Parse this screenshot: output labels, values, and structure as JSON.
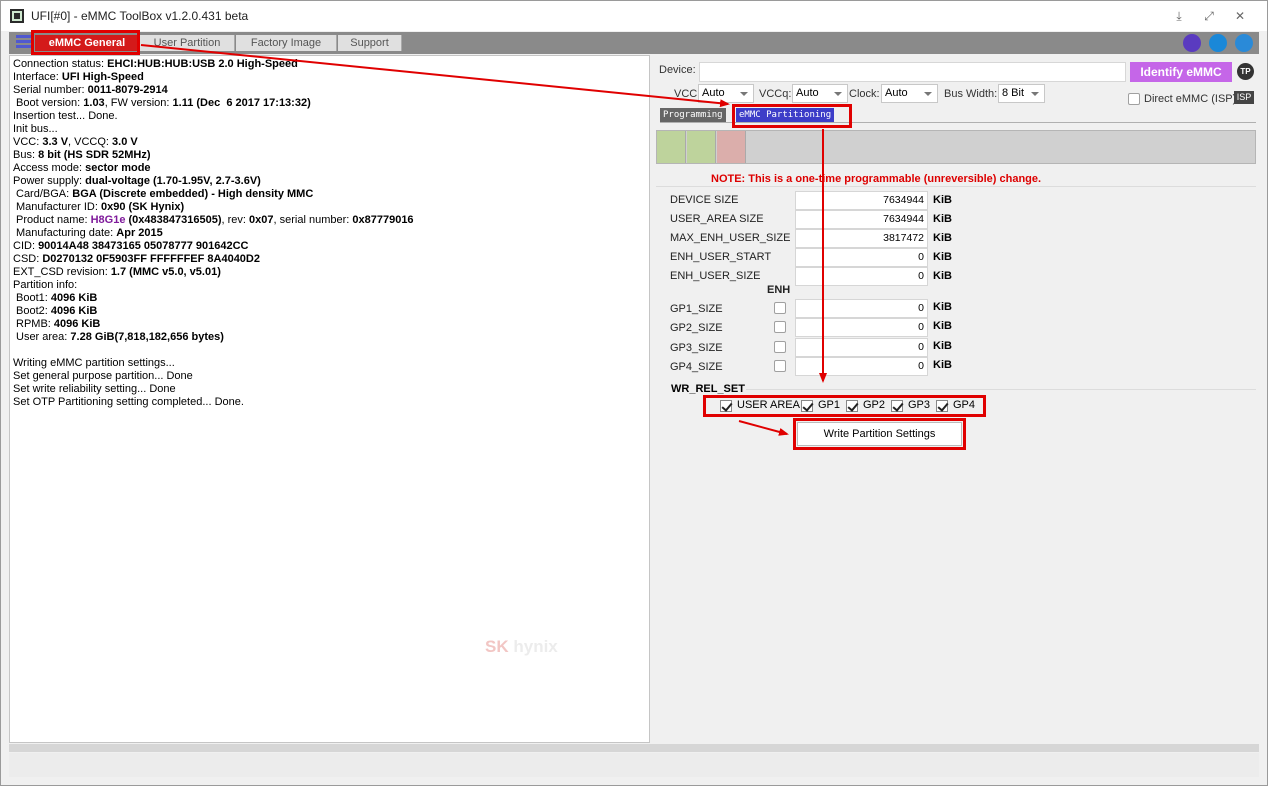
{
  "window": {
    "title": "UFI[#0] - eMMC ToolBox v1.2.0.431 beta"
  },
  "tabs": [
    {
      "label": "eMMC General"
    },
    {
      "label": "User Partition"
    },
    {
      "label": "Factory Image"
    },
    {
      "label": "Support"
    }
  ],
  "log": [
    "Connection status: <b>EHCI:HUB:HUB:USB 2.0 High-Speed</b>",
    "Interface: <b>UFI High-Speed</b>",
    "Serial number: <b>0011-8079-2914</b>",
    "<span class='ind'></span>Boot version: <b>1.03</b>, FW version: <b>1.11 (Dec&nbsp; 6 2017 17:13:32)</b>",
    "Insertion test... Done.",
    "Init bus...",
    "VCC: <b>3.3 V</b>, VCCQ: <b>3.0 V</b>",
    "Bus: <b>8 bit (HS SDR 52MHz)</b>",
    "Access mode: <b>sector mode</b>",
    "Power supply: <b>dual-voltage (1.70-1.95V, 2.7-3.6V)</b>",
    "<span class='ind'></span>Card/BGA: <b>BGA (Discrete embedded) - High density MMC</b>",
    "<span class='ind'></span>Manufacturer ID: <b>0x90 (SK Hynix)</b>",
    "<span class='ind'></span>Product name: <span class='purple'>H8G1e</span> <b>(0x483847316505)</b>, rev: <b>0x07</b>, serial number: <b>0x87779016</b>",
    "<span class='ind'></span>Manufacturing date: <b>Apr 2015</b>",
    "CID: <b>90014A48 38473165 05078777 901642CC</b>",
    "CSD: <b>D0270132 0F5903FF FFFFFFEF 8A4040D2</b>",
    "EXT_CSD revision: <b>1.7 (MMC v5.0, v5.01)</b>",
    "Partition info:",
    "<span class='ind'></span>Boot1: <b>4096 KiB</b>",
    "<span class='ind'></span>Boot2: <b>4096 KiB</b>",
    "<span class='ind'></span>RPMB: <b>4096 KiB</b>",
    "<span class='ind'></span>User area: <b>7.28 GiB(7,818,182,656 bytes)</b>",
    "",
    "Writing eMMC partition settings...",
    "Set general purpose partition... Done",
    "Set write reliability setting... Done",
    "Set OTP Partitioning setting completed... Done."
  ],
  "watermark": {
    "sk": "SK",
    "hynix": "hynix"
  },
  "device": {
    "label": "Device:",
    "value": "",
    "identify_label": "Identify eMMC",
    "tp_label": "TP"
  },
  "power": {
    "vcc_label": "VCC:",
    "vcc_value": "Auto",
    "vccq_label": "VCCq:",
    "vccq_value": "Auto",
    "clock_label": "Clock:",
    "clock_value": "Auto",
    "bus_label": "Bus Width:",
    "bus_value": "8 Bit",
    "direct_label": "Direct eMMC (ISP)",
    "isp_label": "ISP"
  },
  "subtabs": [
    {
      "label": "Programming"
    },
    {
      "label": "eMMC Partitioning"
    }
  ],
  "note": "NOTE: This is a one-time programmable (unreversible) change.",
  "fields": [
    {
      "label": "DEVICE SIZE",
      "value": "7634944",
      "unit": "KiB"
    },
    {
      "label": "USER_AREA SIZE",
      "value": "7634944",
      "unit": "KiB"
    },
    {
      "label": "MAX_ENH_USER_SIZE",
      "value": "3817472",
      "unit": "KiB"
    },
    {
      "label": "ENH_USER_START",
      "value": "0",
      "unit": "KiB"
    },
    {
      "label": "ENH_USER_SIZE",
      "value": "0",
      "unit": "KiB"
    }
  ],
  "enh_label": "ENH",
  "gp_fields": [
    {
      "label": "GP1_SIZE",
      "value": "0",
      "unit": "KiB",
      "enh": false
    },
    {
      "label": "GP2_SIZE",
      "value": "0",
      "unit": "KiB",
      "enh": false
    },
    {
      "label": "GP3_SIZE",
      "value": "0",
      "unit": "KiB",
      "enh": false
    },
    {
      "label": "GP4_SIZE",
      "value": "0",
      "unit": "KiB",
      "enh": false
    }
  ],
  "wr_rel": {
    "label": "WR_REL_SET",
    "items": [
      {
        "label": "USER AREA",
        "checked": true
      },
      {
        "label": "GP1",
        "checked": true
      },
      {
        "label": "GP2",
        "checked": true
      },
      {
        "label": "GP3",
        "checked": true
      },
      {
        "label": "GP4",
        "checked": true
      }
    ]
  },
  "write_button": "Write Partition Settings",
  "colors": {
    "accent_red": "#d41a1a",
    "identify_purple": "#c566e8",
    "partition_green": "#bed39c",
    "partition_pink": "#dbaeab",
    "subtab_active": "#3d3dc8"
  }
}
